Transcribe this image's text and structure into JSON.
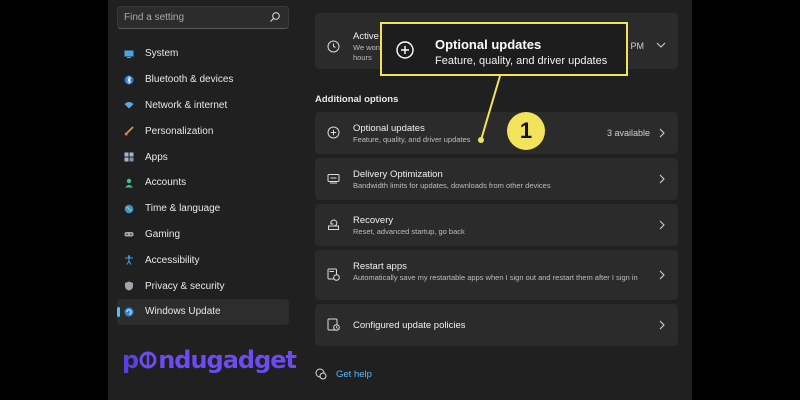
{
  "search": {
    "placeholder": "Find a setting"
  },
  "sidebar": {
    "items": [
      {
        "label": "System",
        "icon": "monitor-icon"
      },
      {
        "label": "Bluetooth & devices",
        "icon": "bluetooth-icon"
      },
      {
        "label": "Network & internet",
        "icon": "wifi-icon"
      },
      {
        "label": "Personalization",
        "icon": "brush-icon"
      },
      {
        "label": "Apps",
        "icon": "apps-icon"
      },
      {
        "label": "Accounts",
        "icon": "person-icon"
      },
      {
        "label": "Time & language",
        "icon": "globe-icon"
      },
      {
        "label": "Gaming",
        "icon": "gamepad-icon"
      },
      {
        "label": "Accessibility",
        "icon": "accessibility-icon"
      },
      {
        "label": "Privacy & security",
        "icon": "shield-icon"
      },
      {
        "label": "Windows Update",
        "icon": "update-icon",
        "selected": true
      }
    ]
  },
  "main": {
    "active_hours": {
      "title": "Active h",
      "sub1": "We won",
      "sub2": "hours",
      "status": "0 PM"
    },
    "section_title": "Additional options",
    "options": [
      {
        "title": "Optional updates",
        "subtitle": "Feature, quality, and driver updates",
        "status": "3 available",
        "icon": "plus-circle-icon"
      },
      {
        "title": "Delivery Optimization",
        "subtitle": "Bandwidth limits for updates, downloads from other devices",
        "icon": "delivery-icon"
      },
      {
        "title": "Recovery",
        "subtitle": "Reset, advanced startup, go back",
        "icon": "recovery-icon"
      },
      {
        "title": "Restart apps",
        "subtitle": "Automatically save my restartable apps when I sign out and restart them after I sign in",
        "icon": "restart-apps-icon"
      },
      {
        "title": "Configured update policies",
        "subtitle": "",
        "icon": "policy-icon"
      }
    ],
    "get_help": "Get help"
  },
  "callout": {
    "title": "Optional updates",
    "subtitle": "Feature, quality, and driver updates",
    "badge": "1"
  },
  "logo": {
    "p": "p",
    "rest": "ndugadget"
  },
  "colors": {
    "accent": "#4cc2ff",
    "highlight": "#f2e35a",
    "logo": "#6a4cf2",
    "link": "#5cb8ff"
  }
}
